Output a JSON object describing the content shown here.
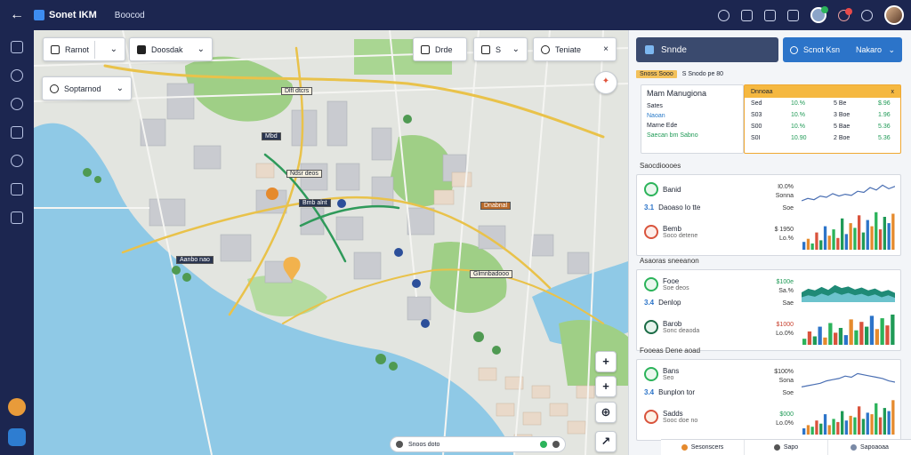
{
  "app": {
    "title": "Sonet IKM",
    "subtitle": "Boocod"
  },
  "map_controls": {
    "layer_select": "Rarnot",
    "view_select": "Doosdak",
    "search": "Soptarnod",
    "btn_a": "Drde",
    "btn_b": "S",
    "btn_c": "Teniate"
  },
  "map_labels": [
    "Dlfl dtcrs",
    "Mbd",
    "Ndsr deos",
    "Bmb alnt",
    "Dnabnal",
    "Aanbo nao",
    "Glmnbadooo"
  ],
  "map_zoom": {
    "zoom_in": "+",
    "rotate": "+",
    "locate": "⊕",
    "compass": "↗"
  },
  "map_status": {
    "text": "Snoos doto"
  },
  "side": {
    "select_a": "Snnde",
    "select_b_left": "Scnot Ksn",
    "select_b_right": "Nakaro",
    "tag_row": {
      "tag": "Snoss Sooo",
      "text": "S  Snodo pe 80"
    },
    "card_mm": {
      "title": "Mam Manugiona",
      "lines": [
        "Sates",
        "Naoan",
        "Marne Ede",
        "Saecan bm Sabno"
      ]
    },
    "table": {
      "header": "Dnnoaa",
      "close": "x",
      "rows": [
        {
          "c1": "Sed",
          "c2": "10.%",
          "c3": "5  Be",
          "c4": "$.96"
        },
        {
          "c1": "S03",
          "c2": "10.%",
          "c3": "3  Boe",
          "c4": "1.96"
        },
        {
          "c1": "S00",
          "c2": "10.%",
          "c3": "5  Bae",
          "c4": "5.36"
        },
        {
          "c1": "S0I",
          "c2": "10.90",
          "c3": "2  Boe",
          "c4": "5.36"
        }
      ]
    },
    "sections": [
      {
        "title": "Saocdioooes",
        "rows": [
          {
            "num": "",
            "label": "Banid",
            "sub": "",
            "icon": "green",
            "val": "I0.0%",
            "val_class": ""
          },
          {
            "num": "3.1",
            "label": "Daoaso lo tte",
            "sub": "",
            "icon": "blue",
            "val": "Soe",
            "val_class": ""
          },
          {
            "num": "",
            "label": "Bemb",
            "sub": "Soco detene",
            "icon": "red",
            "val": "$ 1950",
            "val_class": ""
          }
        ],
        "vals2": [
          "Sonna",
          "",
          "Lo.%"
        ]
      },
      {
        "title": "Asaoras sneeanon",
        "rows": [
          {
            "num": "",
            "label": "Fooe",
            "sub": "Soe deos",
            "icon": "green",
            "val": "$100e",
            "val_class": "green"
          },
          {
            "num": "3.4",
            "label": "Denlop",
            "sub": "",
            "icon": "blue",
            "val": "Sae",
            "val_class": ""
          },
          {
            "num": "",
            "label": "Barob",
            "sub": "Sonc deaoda",
            "icon": "dkgreen",
            "val": "$1000",
            "val_class": "red"
          }
        ],
        "vals2": [
          "Sa.%",
          "",
          "Lo.0%"
        ]
      },
      {
        "title": "Fooeas Dene aoad",
        "rows": [
          {
            "num": "",
            "label": "Bans",
            "sub": "Seo",
            "icon": "green",
            "val": "$100%",
            "val_class": ""
          },
          {
            "num": "3.4",
            "label": "Bunplon tor",
            "sub": "",
            "icon": "blue",
            "val": "Soe",
            "val_class": ""
          },
          {
            "num": "",
            "label": "Sadds",
            "sub": "Sooc doe no",
            "icon": "orange",
            "val": "$000",
            "val_class": "green"
          }
        ],
        "vals2": [
          "Sona",
          "",
          "Lo.0%"
        ]
      }
    ],
    "bottom_bar": [
      "Sesonscers",
      "Sapo",
      "Sapoaoaa"
    ]
  },
  "colors": {
    "nav_bg": "#1c2650",
    "accent_blue": "#2c74c9",
    "accent_orange": "#f0a832",
    "water": "#8fc9e6",
    "green_park": "#9fcf86"
  },
  "chart_data": [
    {
      "type": "bar",
      "title": "",
      "categories": [
        "1",
        "2",
        "3",
        "4",
        "5",
        "6",
        "7",
        "8",
        "9",
        "10",
        "11",
        "12",
        "13",
        "14",
        "15",
        "16",
        "17",
        "18",
        "19",
        "20",
        "21",
        "22"
      ],
      "series": [
        {
          "values": [
            10,
            14,
            8,
            22,
            12,
            30,
            18,
            26,
            15,
            40,
            20,
            34,
            28,
            44,
            22,
            38,
            30,
            48,
            26,
            42,
            34,
            46
          ]
        }
      ],
      "line": [
        22,
        26,
        24,
        30,
        28,
        34,
        30,
        33,
        31,
        38,
        36,
        44,
        40,
        48,
        42,
        46
      ]
    },
    {
      "type": "area",
      "title": "",
      "series": [
        {
          "values": [
            40,
            55,
            48,
            62,
            50,
            70,
            58,
            64,
            52,
            60,
            48,
            56,
            42,
            50,
            38
          ]
        },
        {
          "values": [
            20,
            28,
            22,
            35,
            26,
            40,
            30,
            38,
            28,
            34,
            24,
            32,
            20,
            28,
            18
          ]
        }
      ],
      "bars": [
        10,
        22,
        14,
        30,
        12,
        36,
        20,
        28,
        16,
        42,
        24,
        38,
        30,
        48,
        26,
        44,
        32,
        50
      ]
    },
    {
      "type": "bar",
      "title": "",
      "categories": [
        "1",
        "2",
        "3",
        "4",
        "5",
        "6",
        "7",
        "8",
        "9",
        "10",
        "11",
        "12",
        "13",
        "14",
        "15",
        "16",
        "17",
        "18",
        "19",
        "20",
        "21",
        "22"
      ],
      "series": [
        {
          "values": [
            8,
            12,
            10,
            18,
            14,
            26,
            12,
            20,
            16,
            30,
            18,
            24,
            22,
            36,
            20,
            28,
            26,
            40,
            22,
            34,
            30,
            44
          ]
        }
      ],
      "line": [
        20,
        22,
        24,
        26,
        30,
        32,
        34,
        38,
        36,
        42,
        40,
        38,
        36,
        34,
        30,
        28
      ]
    }
  ]
}
